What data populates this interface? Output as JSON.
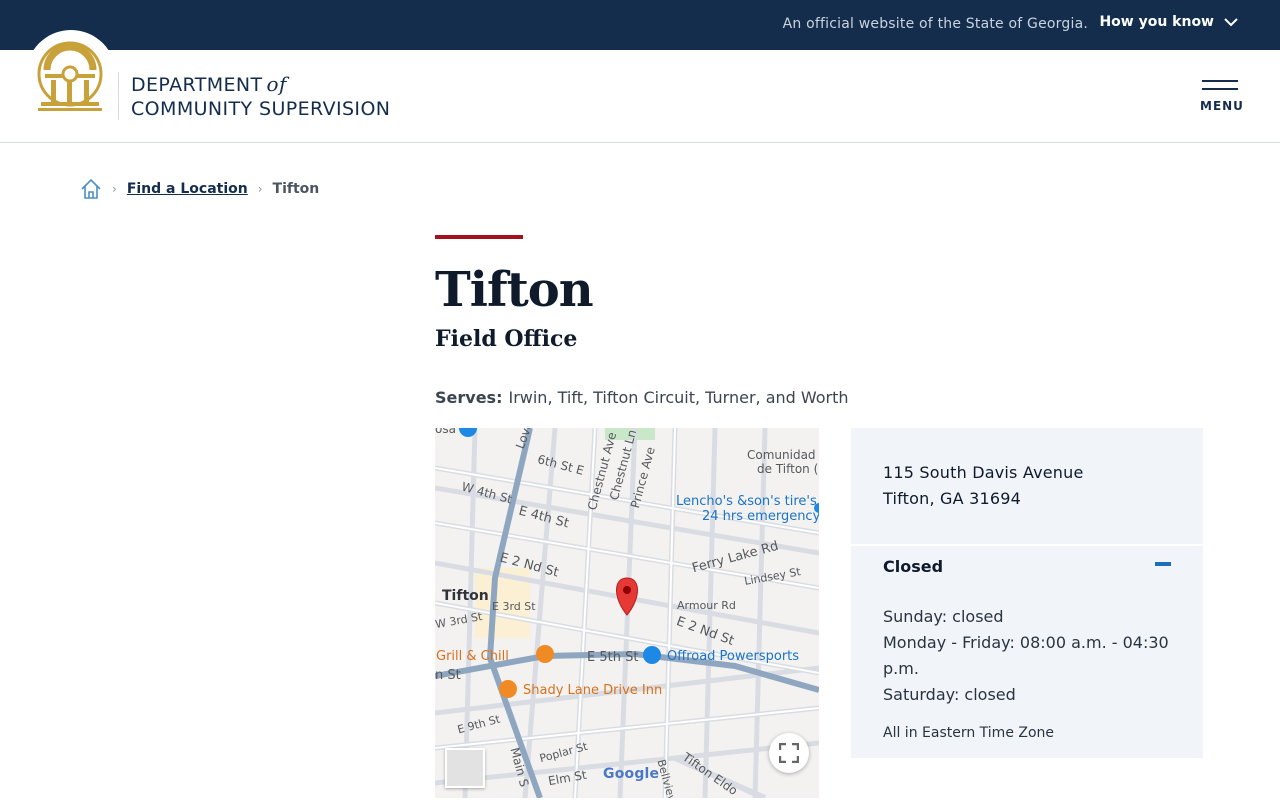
{
  "topbar": {
    "official_text": "An official website of the State of Georgia.",
    "how_you_know": "How you know"
  },
  "header": {
    "brand_line1": "DEPARTMENT",
    "brand_of": "of",
    "brand_line2": "COMMUNITY SUPERVISION",
    "menu_label": "MENU",
    "seal_color": "#c9a13b"
  },
  "breadcrumb": {
    "link": "Find a Location",
    "current": "Tifton"
  },
  "page": {
    "title": "Tifton",
    "subtitle": "Field Office",
    "serves_label": "Serves:",
    "serves_value": "Irwin, Tift, Tifton Circuit, Turner, and Worth",
    "accent_color": "#a3111e"
  },
  "map": {
    "labels": {
      "tifton": "Tifton",
      "love_ave": "Love Ave",
      "sixth_st": "6th St E",
      "w4th": "W 4th St",
      "e4th": "E 4th St",
      "chestnut_ave": "Chestnut Ave",
      "chestnut_ln": "Chestnut Ln",
      "prince_ave": "Prince Ave",
      "comunidad1": "Comunidad",
      "comunidad2": "de Tifton (",
      "lencho1": "Lencho's &son's tire's",
      "lencho2": "24 hrs emergency",
      "e2nd": "E 2 Nd St",
      "ferry": "Ferry Lake Rd",
      "lindsey": "Lindsey St",
      "armour": "Armour Rd",
      "e2nd_b": "E 2 Nd St",
      "e3rd": "E 3rd St",
      "w3rd": "W 3rd St",
      "grill": "Grill & Chill",
      "e5th": "E 5th St",
      "offroad": "Offroad Powersports",
      "shady": "Shady Lane Drive Inn",
      "e9th": "E 9th St",
      "nst": "n St",
      "poplar": "Poplar St",
      "elm": "Elm St",
      "main": "Main S",
      "tifton_eld": "Tifton Eldo",
      "belleview": "Bellview",
      "osa": "osa",
      "google": "Google"
    }
  },
  "card": {
    "address_line1": "115 South Davis Avenue",
    "address_line2": "Tifton, GA 31694",
    "status": "Closed",
    "hours": [
      "Sunday: closed",
      "Monday - Friday: 08:00 a.m. - 04:30 p.m.",
      "Saturday: closed"
    ],
    "timezone": "All in Eastern Time Zone",
    "toggle_color": "#1f6fb5"
  }
}
